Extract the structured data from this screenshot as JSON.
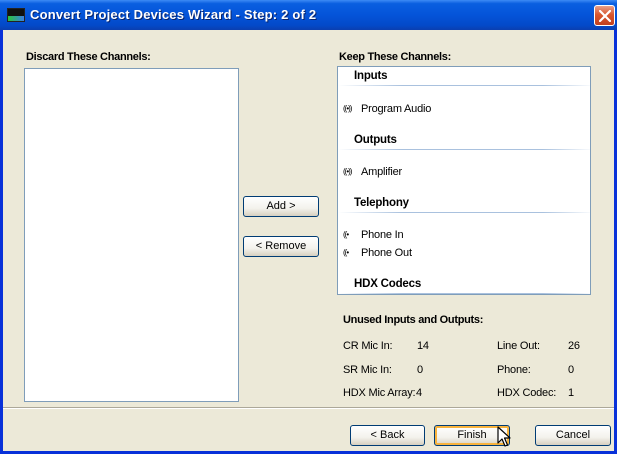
{
  "window": {
    "title": "Convert Project Devices Wizard - Step: 2 of 2"
  },
  "discard": {
    "label": "Discard These Channels:",
    "items": []
  },
  "keep": {
    "label": "Keep These Channels:",
    "groups": [
      {
        "name": "Inputs",
        "channels": [
          {
            "glyph": "((•))",
            "label": "Program Audio"
          }
        ]
      },
      {
        "name": "Outputs",
        "channels": [
          {
            "glyph": "((•))",
            "label": "Amplifier"
          }
        ]
      },
      {
        "name": "Telephony",
        "channels": [
          {
            "glyph": "((•",
            "label": "Phone In"
          },
          {
            "glyph": "((•",
            "label": "Phone Out"
          }
        ]
      },
      {
        "name": "HDX Codecs",
        "channels": []
      }
    ]
  },
  "buttons": {
    "add": "Add >",
    "remove": "< Remove",
    "back": "< Back",
    "finish": "Finish",
    "cancel": "Cancel"
  },
  "unused": {
    "label": "Unused Inputs and Outputs:",
    "left": [
      {
        "label": "CR Mic In:",
        "value": "14"
      },
      {
        "label": "SR Mic In:",
        "value": "0"
      },
      {
        "label": "HDX Mic Array:",
        "value": "4"
      }
    ],
    "right": [
      {
        "label": "Line Out:",
        "value": "26"
      },
      {
        "label": "Phone:",
        "value": "0"
      },
      {
        "label": "HDX Codec:",
        "value": "1"
      }
    ]
  },
  "colors": {
    "title_bar": "#0454d9",
    "dialog_face": "#ece9d8",
    "close_button": "#d8572f",
    "list_border": "#7f9db9",
    "focus_ring": "#f8b33d"
  }
}
